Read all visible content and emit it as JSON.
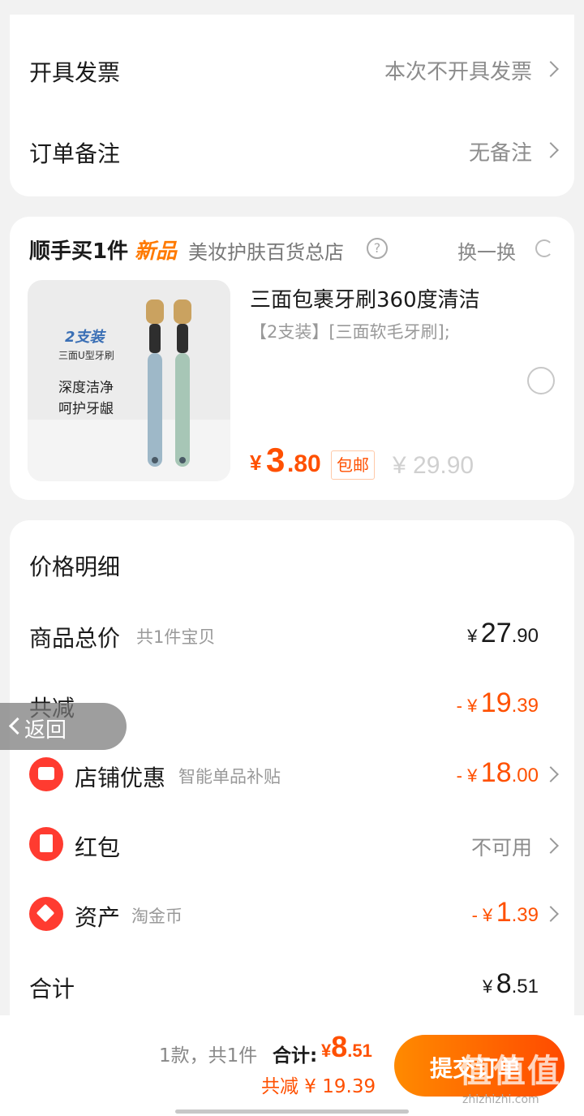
{
  "invoice": {
    "label": "开具发票",
    "value": "本次不开具发票"
  },
  "remark": {
    "label": "订单备注",
    "value": "无备注"
  },
  "addon": {
    "title_prefix": "顺手买1件",
    "title_badge": "新品",
    "store": "美妆护肤百货总店",
    "swap": "换一换",
    "product_title": "三面包裹牙刷360度清洁",
    "product_spec": "【2支装】[三面软毛牙刷];",
    "image_text_1": "2支装",
    "image_text_2": "三面U型牙刷",
    "image_text_3": "深度洁净",
    "image_text_4": "呵护牙龈",
    "price_symbol": "¥",
    "price_int": "3",
    "price_dec": ".80",
    "shipping_tag": "包邮",
    "original_price": "¥ 29.90"
  },
  "detail": {
    "title": "价格明细",
    "goods_total_label": "商品总价",
    "goods_total_note": "共1件宝贝",
    "goods_total_sym": "¥",
    "goods_total_int": "27",
    "goods_total_dec": ".90",
    "reduce_label": "共减",
    "reduce_sym": "- ¥",
    "reduce_int": "19",
    "reduce_dec": ".39",
    "shop_label": "店铺优惠",
    "shop_note": "智能单品补贴",
    "shop_sym": "- ¥",
    "shop_int": "18",
    "shop_dec": ".00",
    "redpacket_label": "红包",
    "redpacket_value": "不可用",
    "asset_label": "资产",
    "asset_note": "淘金币",
    "asset_sym": "- ¥",
    "asset_int": "1",
    "asset_dec": ".39",
    "total_label": "合计",
    "total_sym": "¥",
    "total_int": "8",
    "total_dec": ".51"
  },
  "back": {
    "label": "返回"
  },
  "footer": {
    "count": "1款，共1件",
    "total_label": "合计:",
    "total_sym": "¥",
    "total_int": "8",
    "total_dec": ".51",
    "reduce": "共减 ¥ 19.39",
    "submit": "提交订单",
    "watermark": "值 值 值",
    "watermark_url": "zhizhizhi.com"
  },
  "colors": {
    "accent": "#ff5000",
    "red_icon": "#ff3b30",
    "badge_orange": "#ff7a00"
  }
}
